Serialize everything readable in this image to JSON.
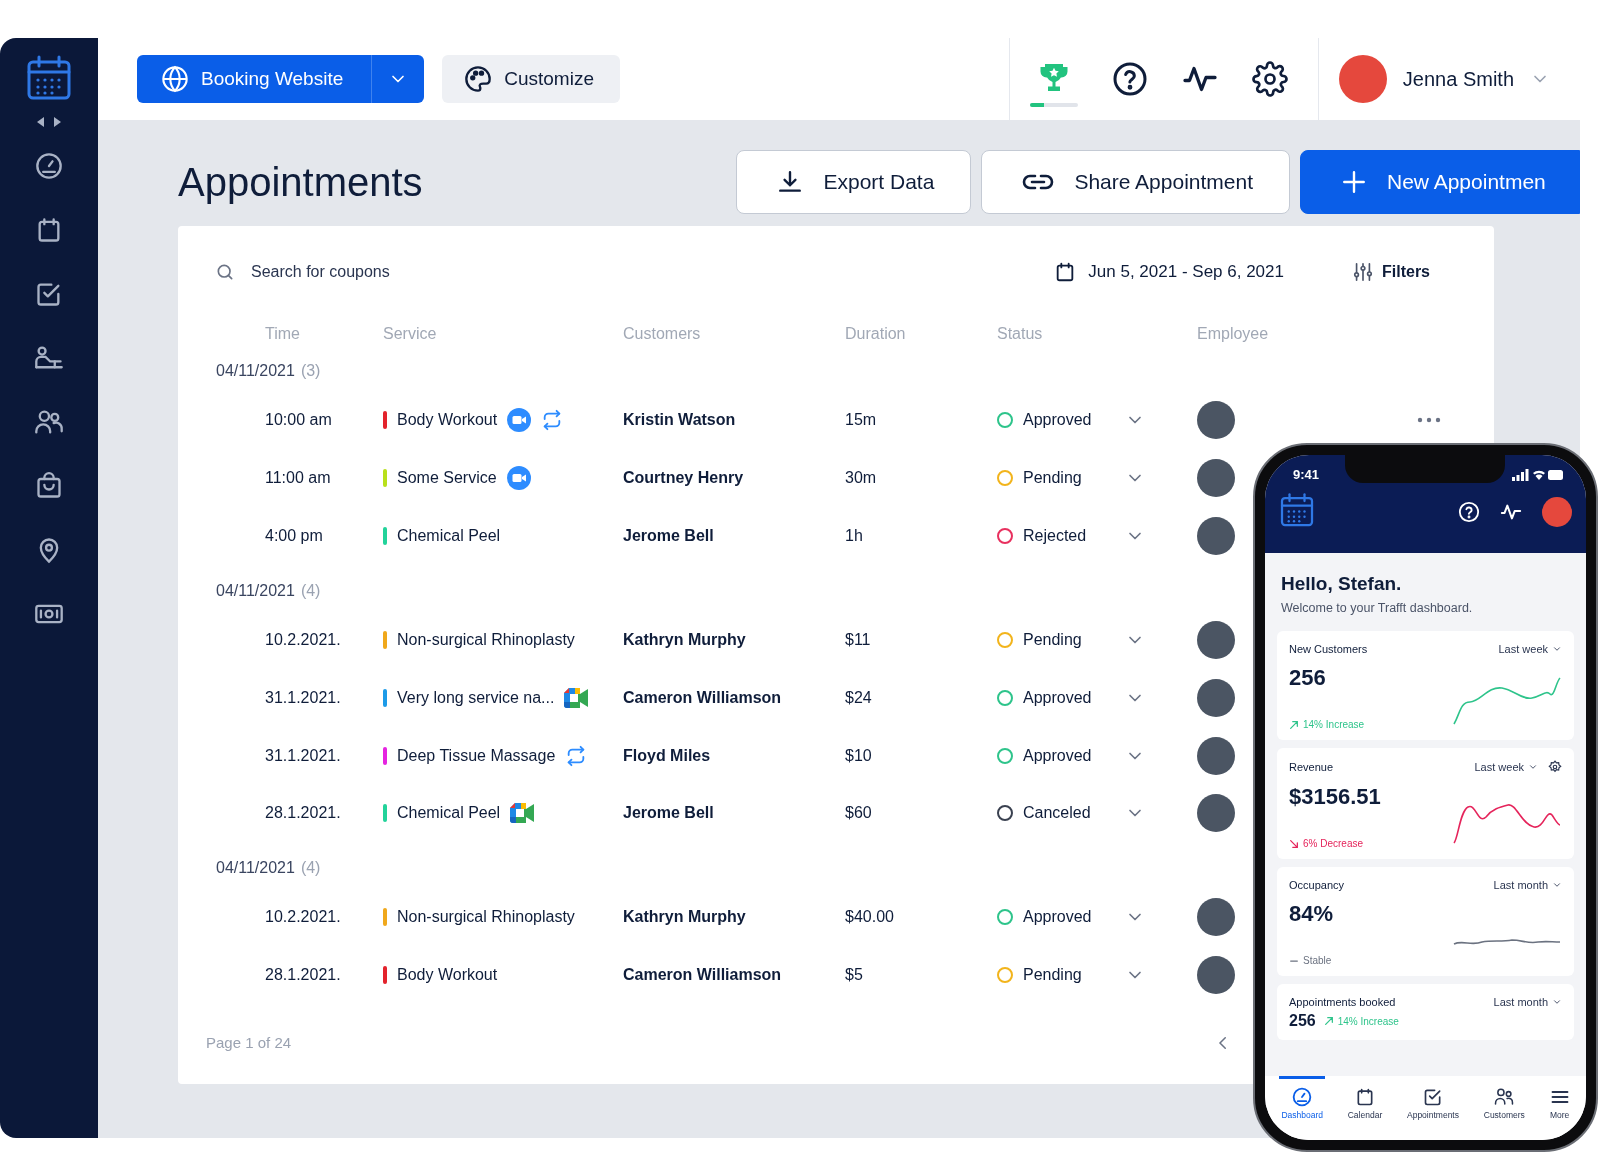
{
  "topbar": {
    "booking_button": "Booking Website",
    "customize_button": "Customize",
    "trophy": {
      "level": 0.3
    },
    "user": {
      "name": "Jenna Smith"
    }
  },
  "page": {
    "title": "Appointments",
    "actions": [
      {
        "label": "Export Data",
        "kind": "export"
      },
      {
        "label": "Share Appointment",
        "kind": "share"
      },
      {
        "label": "New Appointmen",
        "kind": "new"
      }
    ]
  },
  "filters": {
    "search": {
      "placeholder": "Search for coupons"
    },
    "date_range": "Jun 5, 2021 - Sep 6, 2021",
    "filters_button": "Filters"
  },
  "table": {
    "columns": [
      "Time",
      "Service",
      "Customers",
      "Duration",
      "Status",
      "Employee"
    ],
    "groups": [
      {
        "date": "04/11/2021",
        "count": "(3)",
        "rows": [
          {
            "time": "10:00 am",
            "service": {
              "name": "Body Workout",
              "color": "#e3232c"
            },
            "icons": [
              {
                "kind": "video"
              },
              {
                "kind": "repeat"
              }
            ],
            "customer": "Kristin Watson",
            "duration": "15m",
            "status": {
              "label": "Approved",
              "color": "#2ec48b"
            },
            "more": true
          },
          {
            "time": "11:00 am",
            "service": {
              "name": "Some Service",
              "color": "#b8e01c"
            },
            "icons": [
              {
                "kind": "video"
              }
            ],
            "customer": "Courtney Henry",
            "duration": "30m",
            "status": {
              "label": "Pending",
              "color": "#f2b41c"
            }
          },
          {
            "time": "4:00 pm",
            "service": {
              "name": "Chemical Peel",
              "color": "#22d39a"
            },
            "icons": [],
            "customer": "Jerome Bell",
            "duration": "1h",
            "status": {
              "label": "Rejected",
              "color": "#e8305e"
            }
          }
        ]
      },
      {
        "date": "04/11/2021",
        "count": "(4)",
        "rows": [
          {
            "time": "10.2.2021.",
            "service": {
              "name": "Non-surgical Rhinoplasty",
              "color": "#f0a81c"
            },
            "icons": [],
            "customer": "Kathryn Murphy",
            "duration": "$11",
            "status": {
              "label": "Pending",
              "color": "#f2b41c"
            }
          },
          {
            "time": "31.1.2021.",
            "service": {
              "name": "Very long service na...",
              "color": "#1d9be8"
            },
            "icons": [
              {
                "kind": "meet"
              }
            ],
            "customer": "Cameron Williamson",
            "duration": "$24",
            "status": {
              "label": "Approved",
              "color": "#2ec48b"
            }
          },
          {
            "time": "31.1.2021.",
            "service": {
              "name": "Deep Tissue Massage",
              "color": "#e524e0"
            },
            "icons": [
              {
                "kind": "repeat"
              }
            ],
            "customer": "Floyd Miles",
            "duration": "$10",
            "status": {
              "label": "Approved",
              "color": "#2ec48b"
            }
          },
          {
            "time": "28.1.2021.",
            "service": {
              "name": "Chemical Peel",
              "color": "#22d39a"
            },
            "icons": [
              {
                "kind": "meet"
              }
            ],
            "customer": "Jerome Bell",
            "duration": "$60",
            "status": {
              "label": "Canceled",
              "color": "#3a4150"
            }
          }
        ]
      },
      {
        "date": "04/11/2021",
        "count": "(4)",
        "rows": [
          {
            "time": "10.2.2021.",
            "service": {
              "name": "Non-surgical Rhinoplasty",
              "color": "#f0a81c"
            },
            "icons": [],
            "customer": "Kathryn Murphy",
            "duration": "$40.00",
            "status": {
              "label": "Approved",
              "color": "#2ec48b"
            }
          },
          {
            "time": "28.1.2021.",
            "service": {
              "name": "Body Workout",
              "color": "#e3232c"
            },
            "icons": [],
            "customer": "Cameron Williamson",
            "duration": "$5",
            "status": {
              "label": "Pending",
              "color": "#f2b41c"
            }
          }
        ]
      }
    ]
  },
  "pagination": {
    "label": "Page 1 of 24"
  },
  "phone": {
    "time": "9:41",
    "greeting": "Hello, Stefan.",
    "subtitle": "Welcome to your Trafft dashboard.",
    "cards": [
      {
        "kind": "chart",
        "title": "New Customers",
        "period": "Last week",
        "value": "256",
        "trend": {
          "kind": "up",
          "text": "14% Increase"
        },
        "settings": false
      },
      {
        "kind": "chart",
        "title": "Revenue",
        "period": "Last week",
        "value": "$3156.51",
        "trend": {
          "kind": "down",
          "text": "6% Decrease"
        },
        "settings": true
      },
      {
        "kind": "chart",
        "title": "Occupancy",
        "period": "Last month",
        "value": "84%",
        "trend": {
          "kind": "flat",
          "text": "Stable"
        },
        "settings": false
      },
      {
        "kind": "compact",
        "title": "Appointments booked",
        "period": "Last month",
        "value": "256",
        "trend": {
          "kind": "up",
          "text": "14% Increase"
        },
        "settings": false
      }
    ],
    "nav": [
      {
        "label": "Dashboard",
        "kind": "dashboard",
        "selected": true
      },
      {
        "label": "Calendar",
        "kind": "calendar",
        "selected": false
      },
      {
        "label": "Appointments",
        "kind": "check",
        "selected": false
      },
      {
        "label": "Customers",
        "kind": "people",
        "selected": false
      },
      {
        "label": "More",
        "kind": "menu",
        "selected": false
      }
    ]
  }
}
